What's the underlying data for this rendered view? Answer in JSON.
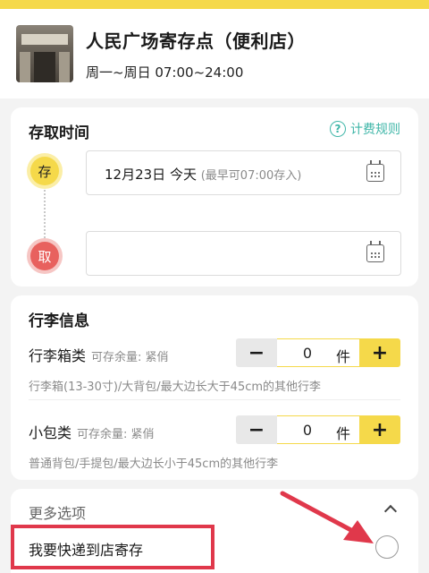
{
  "colors": {
    "accent": "#f5d94a",
    "teal": "#3fb6a8",
    "red": "#e8615e",
    "highlight": "#e0384b"
  },
  "store": {
    "name": "人民广场寄存点（便利店）",
    "hours": "周一~周日 07:00~24:00"
  },
  "time_card": {
    "title": "存取时间",
    "rule_link": "计费规则",
    "store_badge": "存",
    "pick_badge": "取",
    "store_time": "12月23日 今天",
    "store_hint": "(最早可07:00存入)",
    "pick_time": ""
  },
  "luggage_card": {
    "title": "行李信息",
    "items": [
      {
        "name": "行李箱类",
        "remain": "可存余量: 紧俏",
        "count": "0",
        "unit": "件",
        "desc": "行李箱(13-30寸)/大背包/最大边长大于45cm的其他行李"
      },
      {
        "name": "小包类",
        "remain": "可存余量: 紧俏",
        "count": "0",
        "unit": "件",
        "desc": "普通背包/手提包/最大边长小于45cm的其他行李"
      }
    ],
    "minus": "−",
    "plus": "+"
  },
  "more_card": {
    "title": "更多选项",
    "express_label": "我要快递到店寄存"
  }
}
